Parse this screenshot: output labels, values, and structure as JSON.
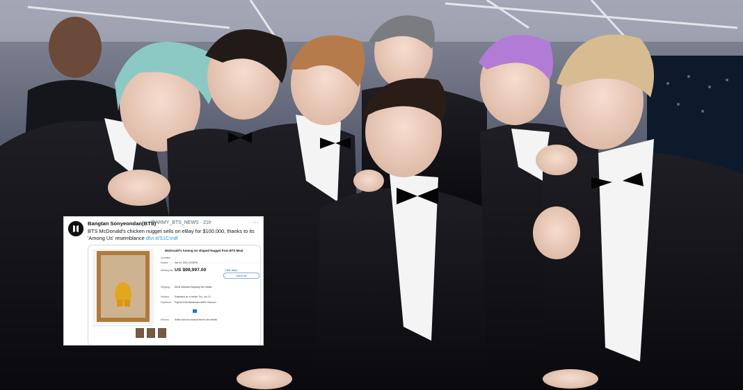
{
  "tweet": {
    "name": "Bangtan Sonyeondan(BTS)",
    "handle": "@ARMY_BTS_NEWS · 21h",
    "more": "···",
    "text": "BTS McDonald's chicken nugget sells on eBay for $100,000, thanks to its 'Among Us' resemblance",
    "link": "dlvr.it/S1Cmdf"
  },
  "ebay": {
    "title": "McDonald's Among Us shaped Nugget from BTS Meal",
    "rows": [
      {
        "label": "Condition:",
        "value": "--"
      },
      {
        "label": "Ended:",
        "value": "Jun 04, 2021 10:04PM"
      },
      {
        "label": "Winning bid:",
        "value": "US $99,997.00"
      },
      {
        "label": "Shipping:",
        "value": "$8.05 Standard Shipping  See details"
      },
      {
        "label": "Delivery:",
        "value": "Estimated on or before Thu, Jun 10"
      },
      {
        "label": "Payments:",
        "value": "PayPal  VISA  Mastercard  AMEX  Discover"
      },
      {
        "label": "Returns:",
        "value": "Seller does not accept returns  See details"
      }
    ],
    "bid_info": "2 bids (bids)",
    "add_to_list": "Add to list"
  },
  "colors": {
    "tweet_bg": "#ffffff",
    "link": "#1d9bf0",
    "ebay_blue": "#0654ba",
    "suit": "#111114"
  }
}
